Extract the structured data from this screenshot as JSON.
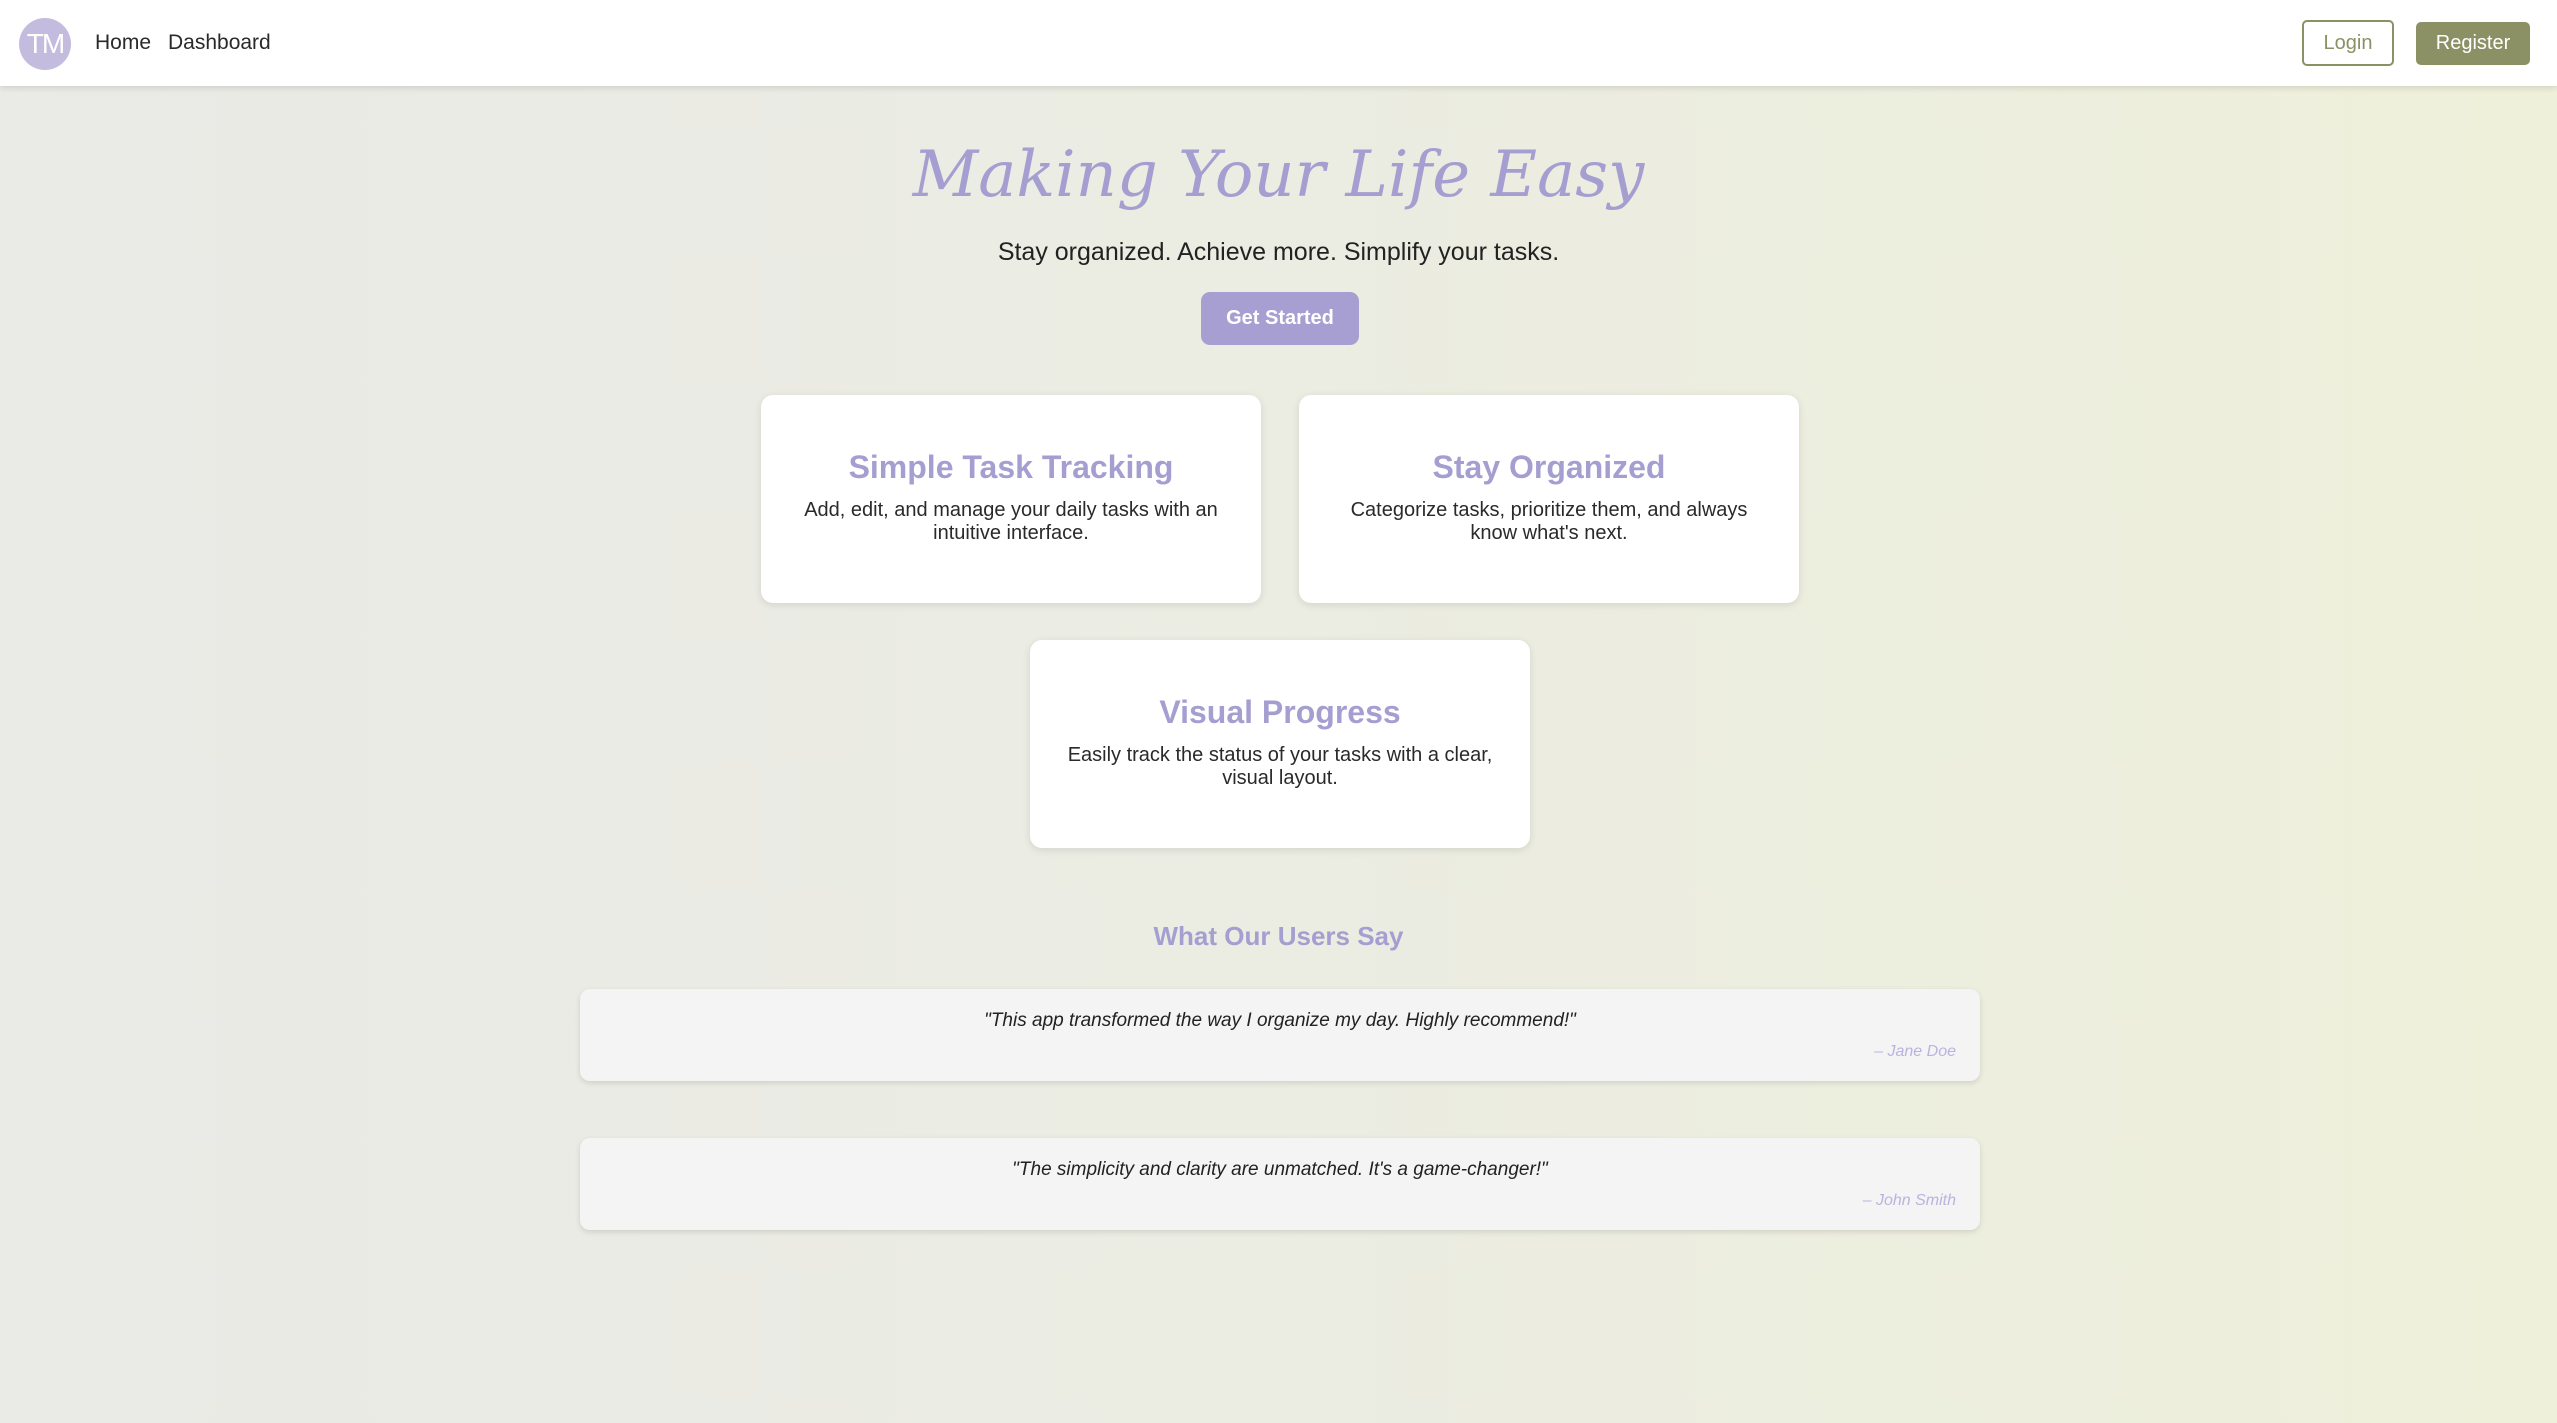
{
  "nav": {
    "logo_text": "TM",
    "links": [
      {
        "label": "Home"
      },
      {
        "label": "Dashboard"
      }
    ],
    "login_label": "Login",
    "register_label": "Register"
  },
  "hero": {
    "title": "Making Your Life Easy",
    "subtitle": "Stay organized. Achieve more. Simplify your tasks.",
    "cta_label": "Get Started"
  },
  "features": [
    {
      "title": "Simple Task Tracking",
      "text": "Add, edit, and manage your daily tasks with an intuitive interface."
    },
    {
      "title": "Stay Organized",
      "text": "Categorize tasks, prioritize them, and always know what's next."
    },
    {
      "title": "Visual Progress",
      "text": "Easily track the status of your tasks with a clear, visual layout."
    }
  ],
  "testimonials": {
    "heading": "What Our Users Say",
    "items": [
      {
        "quote": "\"This app transformed the way I organize my day. Highly recommend!\"",
        "author": "– Jane Doe"
      },
      {
        "quote": "\"The simplicity and clarity are unmatched. It's a game-changer!\"",
        "author": "– John Smith"
      }
    ]
  },
  "colors": {
    "accent_purple": "#a59ed1",
    "olive": "#8b9164",
    "author_text": "#bab3df"
  }
}
